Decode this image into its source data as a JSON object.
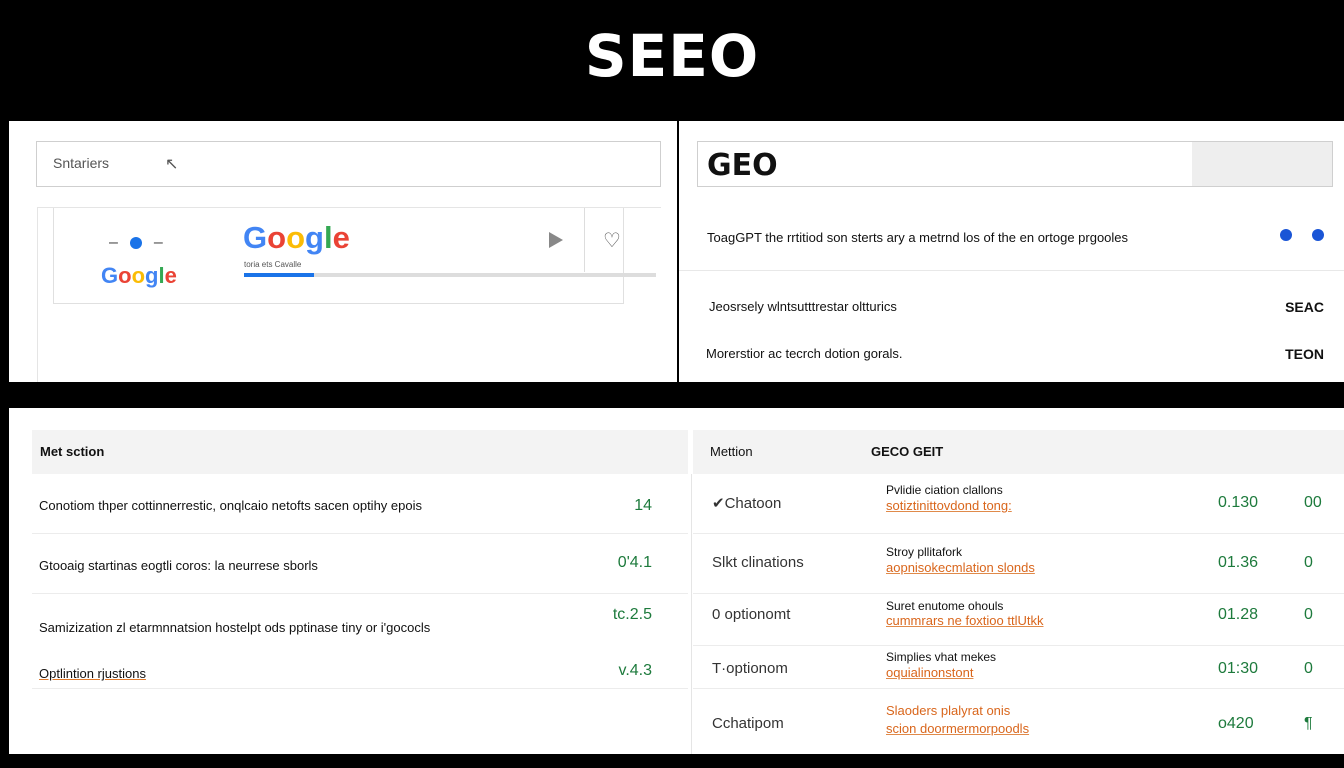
{
  "title": "SEEO",
  "top_left": {
    "search_text": "Sntariers",
    "logo_small": [
      "G",
      "o",
      "o",
      "g",
      "l",
      "e"
    ],
    "logo_big": [
      "G",
      "o",
      "o",
      "g",
      "l",
      "e"
    ],
    "logo_sub": "toria ets Cavalle",
    "progress": 0.17
  },
  "top_right": {
    "geo_label": "GEO",
    "row1_text": "ToagGPT the rrtitiod son sterts ary a metrnd los of the en ortoge prgooles",
    "row2_text": "Jeosrsely wlntsutttrestar oltturics",
    "row2_code": "SEAC",
    "row3_text": "Morerstior ac tecrch dotion gorals.",
    "row3_code": "TEON"
  },
  "bottom": {
    "left_header": "Met sction",
    "right_header_1": "Mettion",
    "right_header_2": "GECO GEIT",
    "left_rows": [
      {
        "text": "Conotiom thper cottinnerrestic, onqlcaio netofts sacen optihy epois",
        "value": "14"
      },
      {
        "text": "Gtooaig startinas eogtli coros: la neurrese sborls",
        "value": "0'4.1"
      },
      {
        "text": "Samizization zl etarmnnatsion hostelpt ods pptinase tiny or i'gococls",
        "value": "tc.2.5"
      },
      {
        "text": "Optlintion rjustions",
        "value": "v.4.3"
      }
    ],
    "right_rows": [
      {
        "method": "✔Chatoon",
        "desc1": "Pvlidie ciation clallons",
        "desc2": "sotiztinittovdond tong:",
        "score": "0.130",
        "score2": "00"
      },
      {
        "method": "Slkt clinations",
        "desc1": "Stroy pllitafork",
        "desc2": "aopnisokecmlation slonds",
        "score": "01.36",
        "score2": "0"
      },
      {
        "method": "0 optionomt",
        "desc1": "Suret enutome ohouls",
        "desc2": "cummrars ne foxtioo ttlUtkk",
        "score": "01.28",
        "score2": "0"
      },
      {
        "method": "T·optionom",
        "desc1": "Simplies vhat mekes",
        "desc2": "oquialinonstont",
        "score": "01:30",
        "score2": "0"
      },
      {
        "method": "Cchatipom",
        "desc1": "Slaoders plalyrat onis",
        "desc2": "scion doormermorpoodls",
        "score": "o420",
        "score2": "¶"
      }
    ]
  }
}
